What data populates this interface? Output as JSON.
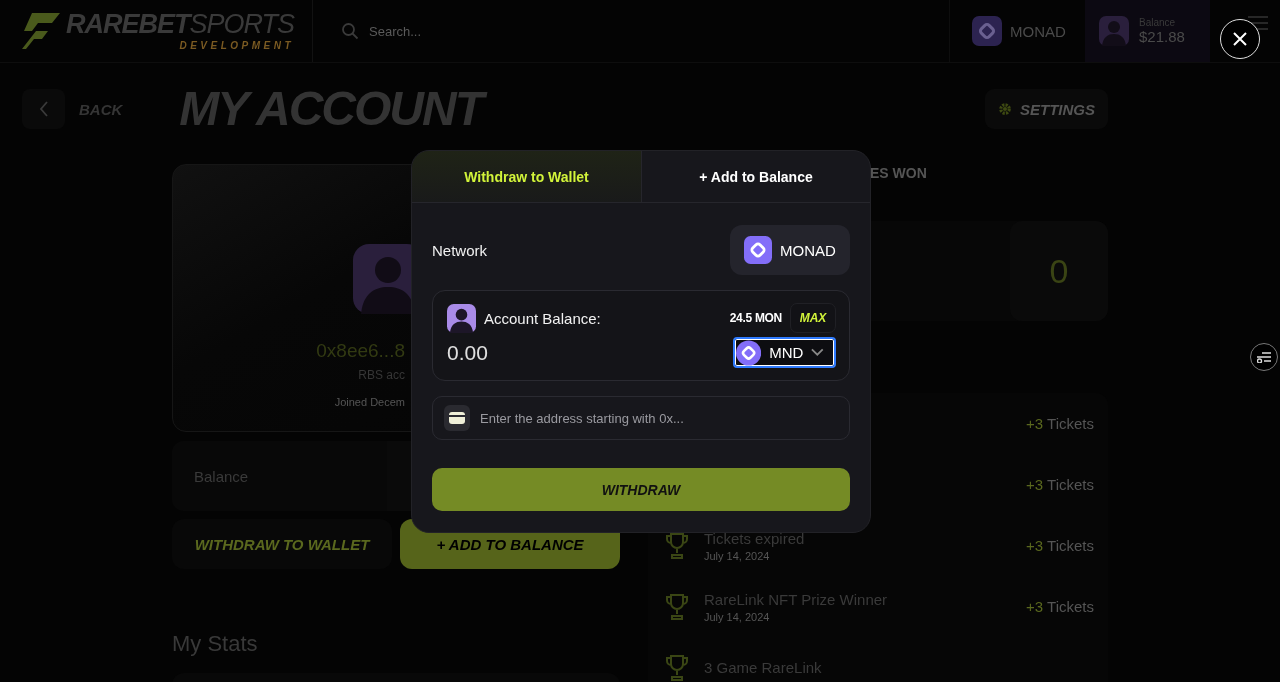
{
  "header": {
    "logo": {
      "word_1": "RAREBET",
      "word_2": "SPORTS",
      "tagline": "DEVELOPMENT"
    },
    "search": {
      "placeholder": "Search..."
    },
    "network": "MONAD",
    "balance_label": "Balance",
    "balance_value": "$21.88"
  },
  "page": {
    "back_label": "BACK",
    "title": "MY ACCOUNT",
    "settings_label": "SETTINGS"
  },
  "profile": {
    "address": "0x8ee6...8",
    "subtitle": "RBS acc",
    "joined": "Joined Decem"
  },
  "balance_card": {
    "label": "Balance"
  },
  "actions": [
    {
      "label": "WITHDRAW TO WALLET",
      "kind": "outline"
    },
    {
      "label": "+ ADD TO BALANCE",
      "kind": "filled"
    }
  ],
  "stats_heading": "My Stats",
  "right_tab_fragment": "ES WON",
  "stat_value": "0",
  "activity": [
    {
      "amount": "+3",
      "unit": "Tickets"
    },
    {
      "amount": "+3",
      "unit": "Tickets"
    },
    {
      "title": "Tickets expired",
      "date": "July 14, 2024",
      "amount": "+3",
      "unit": "Tickets"
    },
    {
      "title": "RareLink NFT Prize Winner",
      "date": "July 14, 2024",
      "amount": "+3",
      "unit": "Tickets"
    },
    {
      "title": "3 Game RareLink"
    }
  ],
  "modal": {
    "tabs": [
      {
        "label": "Withdraw to Wallet",
        "selected": true
      },
      {
        "label": "+ Add to Balance",
        "selected": false
      }
    ],
    "network_label": "Network",
    "network_value": "MONAD",
    "balance_label": "Account Balance:",
    "available": "24.5 MON",
    "max_label": "MAX",
    "amount": "0.00",
    "token": "MND",
    "address": {
      "placeholder": "Enter the address starting with 0x..."
    },
    "submit": "WITHDRAW"
  }
}
